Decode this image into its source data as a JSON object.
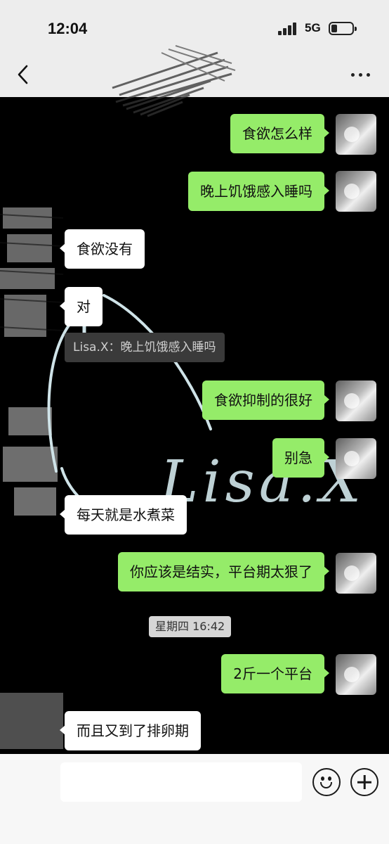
{
  "status_bar": {
    "time": "12:04",
    "network": "5G"
  },
  "header": {
    "back_icon": "chevron-left-icon",
    "more_icon": "more-dots-icon"
  },
  "messages": [
    {
      "side": "out",
      "text": "食欲怎么样"
    },
    {
      "side": "out",
      "text": "晚上饥饿感入睡吗"
    },
    {
      "side": "in",
      "text": "食欲没有"
    },
    {
      "side": "in",
      "text": "对"
    },
    {
      "side": "out",
      "text": "食欲抑制的很好"
    },
    {
      "side": "out",
      "text": "别急"
    },
    {
      "side": "in",
      "text": "每天就是水煮菜"
    },
    {
      "side": "out",
      "text": "你应该是结实，平台期太狠了"
    },
    {
      "side": "out",
      "text": "2斤一个平台"
    },
    {
      "side": "in",
      "text": "而且又到了排卵期"
    }
  ],
  "quote": "Lisa.X：晚上饥饿感入睡吗",
  "timestamp": "星期四 16:42",
  "watermark": "Lisa.X",
  "input_bar": {
    "input_value": "",
    "emoji_icon": "emoji-smile-icon",
    "plus_icon": "plus-circle-icon"
  },
  "colors": {
    "outgoing_bubble": "#95ec69",
    "incoming_bubble": "#ffffff",
    "chat_background": "#000000",
    "header_background": "#ededed"
  }
}
